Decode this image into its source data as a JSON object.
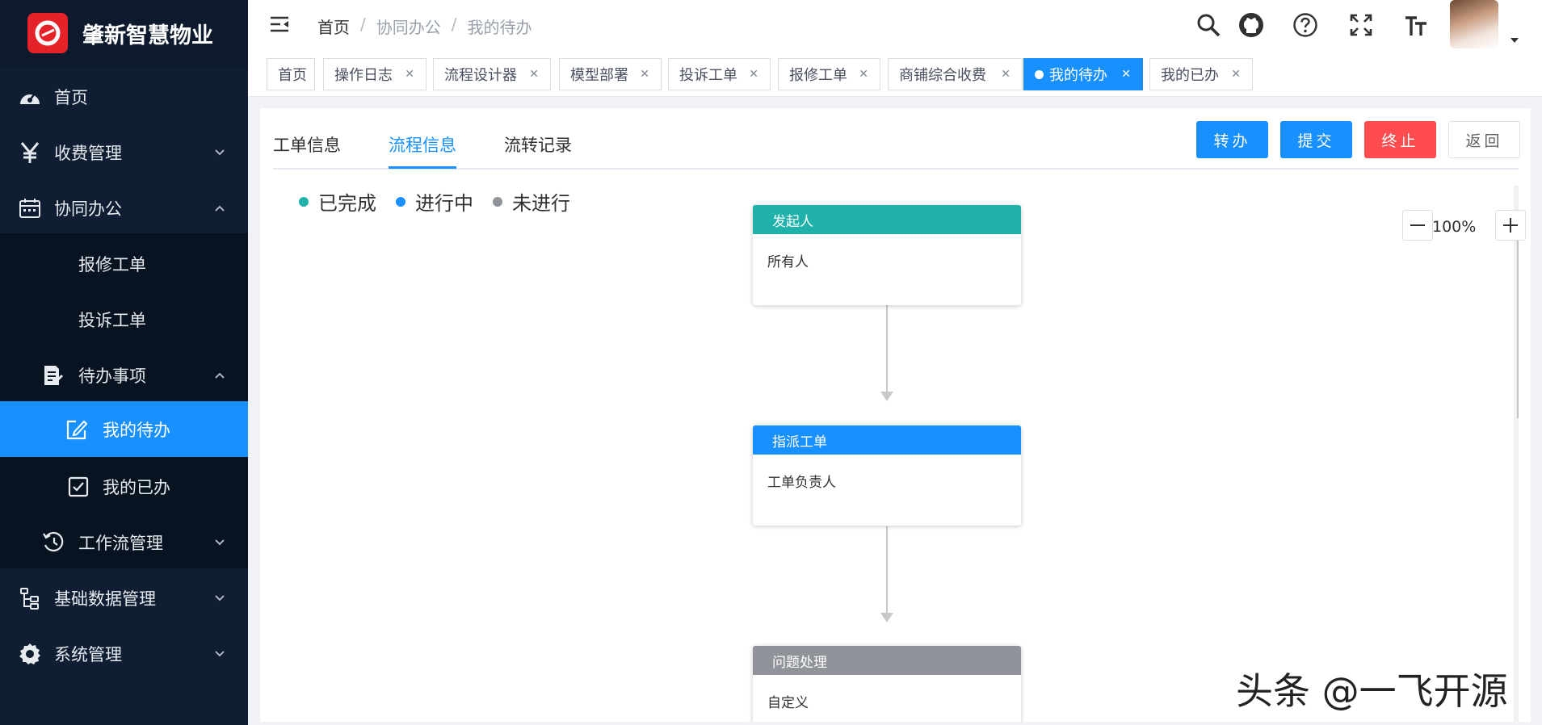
{
  "app": {
    "title": "肇新智慧物业"
  },
  "sidebar": {
    "items": [
      {
        "label": "首页",
        "icon": "dashboard-icon"
      },
      {
        "label": "收费管理",
        "icon": "yen-icon"
      },
      {
        "label": "协同办公",
        "icon": "calendar-icon"
      },
      {
        "label": "报修工单"
      },
      {
        "label": "投诉工单"
      },
      {
        "label": "待办事项",
        "icon": "todo-icon"
      },
      {
        "label": "我的待办",
        "icon": "edit-icon"
      },
      {
        "label": "我的已办",
        "icon": "checkbox-icon"
      },
      {
        "label": "工作流管理",
        "icon": "history-icon"
      },
      {
        "label": "基础数据管理",
        "icon": "tree-icon"
      },
      {
        "label": "系统管理",
        "icon": "gear-icon"
      }
    ]
  },
  "header": {
    "breadcrumb": [
      "首页",
      "协同办公",
      "我的待办"
    ],
    "separator": "/"
  },
  "tags": [
    {
      "label": "首页"
    },
    {
      "label": "操作日志"
    },
    {
      "label": "流程设计器"
    },
    {
      "label": "模型部署"
    },
    {
      "label": "投诉工单"
    },
    {
      "label": "报修工单"
    },
    {
      "label": "商铺综合收费"
    },
    {
      "label": "我的待办"
    },
    {
      "label": "我的已办"
    }
  ],
  "tabs": [
    "工单信息",
    "流程信息",
    "流转记录"
  ],
  "buttons": {
    "transfer": "转办",
    "submit": "提交",
    "stop": "终止",
    "back": "返回"
  },
  "legend": [
    {
      "label": "已完成",
      "color": "#20b2aa"
    },
    {
      "label": "进行中",
      "color": "#1890ff"
    },
    {
      "label": "未进行",
      "color": "#909399"
    }
  ],
  "flow": {
    "nodes": [
      {
        "title": "发起人",
        "body": "所有人",
        "color": "#20b2aa"
      },
      {
        "title": "指派工单",
        "body": "工单负责人",
        "color": "#1890ff"
      },
      {
        "title": "问题处理",
        "body": "自定义",
        "color": "#909399"
      }
    ],
    "zoom": "100%"
  },
  "watermark": "头条 @一飞开源",
  "colors": {
    "accent": "#1890ff",
    "danger": "#ff4d4f",
    "sidebar": "#0f1e33"
  }
}
